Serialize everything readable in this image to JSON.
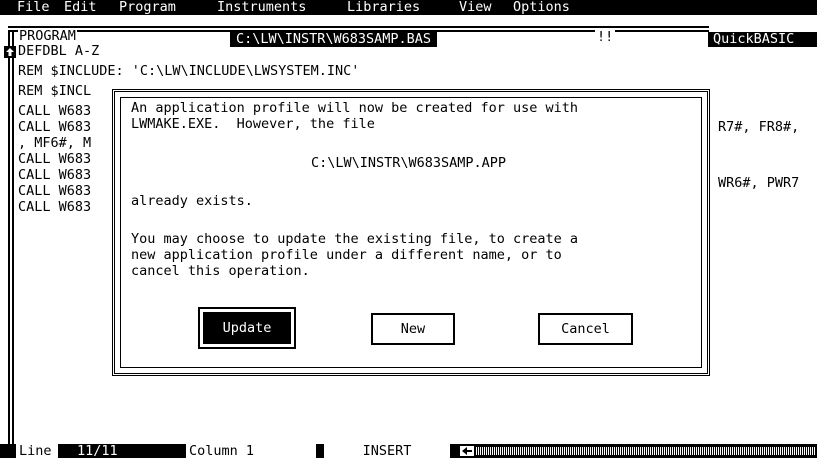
{
  "menu": [
    "File",
    "Edit",
    "Program",
    "Instruments",
    "Libraries",
    "View",
    "Options"
  ],
  "window": {
    "section_label": "PROGRAM",
    "file_path": "C:\\LW\\INSTR\\W683SAMP.BAS",
    "marker": "!!",
    "app_name": "QuickBASIC"
  },
  "editor": {
    "lines": [
      "DEFDBL A-Z",
      "REM $INCLUDE: 'C:\\LW\\INCLUDE\\LWSYSTEM.INC'",
      "REM $INCL",
      "CALL W683",
      "CALL W683",
      ", MF6#, M",
      "CALL W683",
      "CALL W683",
      "CALL W683",
      "CALL W683"
    ],
    "right_fragments": [
      "R7#, FR8#,",
      "WR6#, PWR7"
    ]
  },
  "dialog": {
    "line1": "An application profile will now be created for use with",
    "line2": "LWMAKE.EXE.  However, the file",
    "path": "C:\\LW\\INSTR\\W683SAMP.APP",
    "exists": "already exists.",
    "choose1": "You may choose to update the existing file, to create a",
    "choose2": "new application profile under a different name, or to",
    "choose3": "cancel this operation.",
    "buttons": {
      "update": "Update",
      "new": "New",
      "cancel": "Cancel"
    }
  },
  "status": {
    "line": "Line",
    "line_value": "11/11",
    "column": "Column 1",
    "mode": "INSERT"
  }
}
